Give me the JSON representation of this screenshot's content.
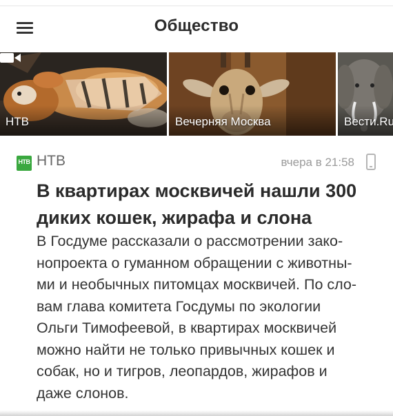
{
  "header": {
    "title": "Общество",
    "menu_icon": "hamburger-menu-icon"
  },
  "carousel": {
    "items": [
      {
        "source": "НТВ",
        "image": "tiger and dog lying together",
        "has_video": true,
        "video_icon": "video-camera-icon"
      },
      {
        "source": "Вечерняя Москва",
        "image": "giraffe head close-up",
        "has_video": false
      },
      {
        "source": "Вести.Ru",
        "image": "elephant",
        "has_video": false
      }
    ]
  },
  "article": {
    "source": "НТВ",
    "source_logo": "НТВ",
    "source_color": "#3aa83f",
    "timestamp": "вчера в 21:58",
    "device_icon": "mobile-phone-icon",
    "headline_lines": [
      "В квартирах москвичей нашли 300",
      "диких кошек, жирафа и слона"
    ],
    "body_lines": [
      "В Госдуме рассказали о рассмотрении зако-",
      "нопроекта о гуманном обращении с животны-",
      "ми и необычных питомцах москвичей. По сло-",
      "вам глава комитета Госдумы по экологии",
      "Ольги Тимофеевой, в квартирах москвичей",
      "можно найти не только привычных кошек и",
      "собак, но и тигров, леопардов, жирафов и",
      "даже слонов."
    ]
  }
}
